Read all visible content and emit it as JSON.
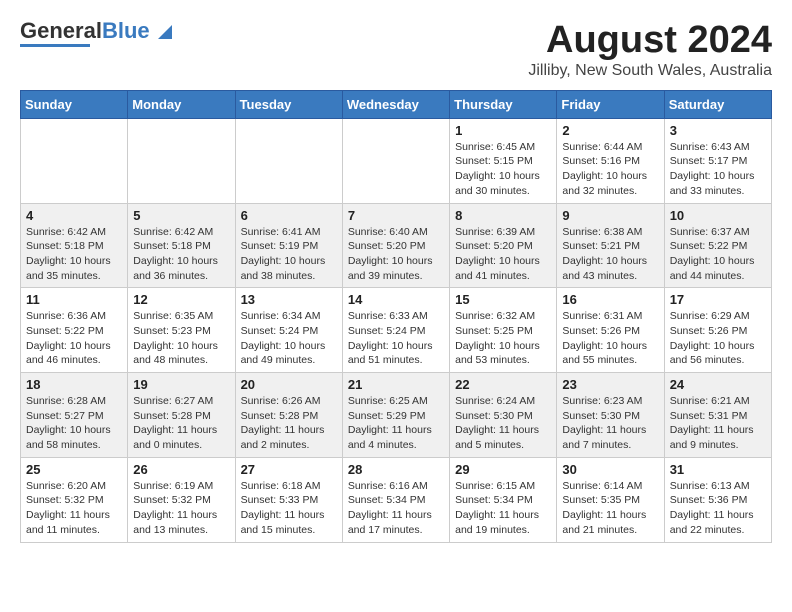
{
  "header": {
    "logo_general": "General",
    "logo_blue": "Blue",
    "month_title": "August 2024",
    "location": "Jilliby, New South Wales, Australia"
  },
  "days_of_week": [
    "Sunday",
    "Monday",
    "Tuesday",
    "Wednesday",
    "Thursday",
    "Friday",
    "Saturday"
  ],
  "weeks": [
    [
      {
        "day": "",
        "info": ""
      },
      {
        "day": "",
        "info": ""
      },
      {
        "day": "",
        "info": ""
      },
      {
        "day": "",
        "info": ""
      },
      {
        "day": "1",
        "info": "Sunrise: 6:45 AM\nSunset: 5:15 PM\nDaylight: 10 hours\nand 30 minutes."
      },
      {
        "day": "2",
        "info": "Sunrise: 6:44 AM\nSunset: 5:16 PM\nDaylight: 10 hours\nand 32 minutes."
      },
      {
        "day": "3",
        "info": "Sunrise: 6:43 AM\nSunset: 5:17 PM\nDaylight: 10 hours\nand 33 minutes."
      }
    ],
    [
      {
        "day": "4",
        "info": "Sunrise: 6:42 AM\nSunset: 5:18 PM\nDaylight: 10 hours\nand 35 minutes."
      },
      {
        "day": "5",
        "info": "Sunrise: 6:42 AM\nSunset: 5:18 PM\nDaylight: 10 hours\nand 36 minutes."
      },
      {
        "day": "6",
        "info": "Sunrise: 6:41 AM\nSunset: 5:19 PM\nDaylight: 10 hours\nand 38 minutes."
      },
      {
        "day": "7",
        "info": "Sunrise: 6:40 AM\nSunset: 5:20 PM\nDaylight: 10 hours\nand 39 minutes."
      },
      {
        "day": "8",
        "info": "Sunrise: 6:39 AM\nSunset: 5:20 PM\nDaylight: 10 hours\nand 41 minutes."
      },
      {
        "day": "9",
        "info": "Sunrise: 6:38 AM\nSunset: 5:21 PM\nDaylight: 10 hours\nand 43 minutes."
      },
      {
        "day": "10",
        "info": "Sunrise: 6:37 AM\nSunset: 5:22 PM\nDaylight: 10 hours\nand 44 minutes."
      }
    ],
    [
      {
        "day": "11",
        "info": "Sunrise: 6:36 AM\nSunset: 5:22 PM\nDaylight: 10 hours\nand 46 minutes."
      },
      {
        "day": "12",
        "info": "Sunrise: 6:35 AM\nSunset: 5:23 PM\nDaylight: 10 hours\nand 48 minutes."
      },
      {
        "day": "13",
        "info": "Sunrise: 6:34 AM\nSunset: 5:24 PM\nDaylight: 10 hours\nand 49 minutes."
      },
      {
        "day": "14",
        "info": "Sunrise: 6:33 AM\nSunset: 5:24 PM\nDaylight: 10 hours\nand 51 minutes."
      },
      {
        "day": "15",
        "info": "Sunrise: 6:32 AM\nSunset: 5:25 PM\nDaylight: 10 hours\nand 53 minutes."
      },
      {
        "day": "16",
        "info": "Sunrise: 6:31 AM\nSunset: 5:26 PM\nDaylight: 10 hours\nand 55 minutes."
      },
      {
        "day": "17",
        "info": "Sunrise: 6:29 AM\nSunset: 5:26 PM\nDaylight: 10 hours\nand 56 minutes."
      }
    ],
    [
      {
        "day": "18",
        "info": "Sunrise: 6:28 AM\nSunset: 5:27 PM\nDaylight: 10 hours\nand 58 minutes."
      },
      {
        "day": "19",
        "info": "Sunrise: 6:27 AM\nSunset: 5:28 PM\nDaylight: 11 hours\nand 0 minutes."
      },
      {
        "day": "20",
        "info": "Sunrise: 6:26 AM\nSunset: 5:28 PM\nDaylight: 11 hours\nand 2 minutes."
      },
      {
        "day": "21",
        "info": "Sunrise: 6:25 AM\nSunset: 5:29 PM\nDaylight: 11 hours\nand 4 minutes."
      },
      {
        "day": "22",
        "info": "Sunrise: 6:24 AM\nSunset: 5:30 PM\nDaylight: 11 hours\nand 5 minutes."
      },
      {
        "day": "23",
        "info": "Sunrise: 6:23 AM\nSunset: 5:30 PM\nDaylight: 11 hours\nand 7 minutes."
      },
      {
        "day": "24",
        "info": "Sunrise: 6:21 AM\nSunset: 5:31 PM\nDaylight: 11 hours\nand 9 minutes."
      }
    ],
    [
      {
        "day": "25",
        "info": "Sunrise: 6:20 AM\nSunset: 5:32 PM\nDaylight: 11 hours\nand 11 minutes."
      },
      {
        "day": "26",
        "info": "Sunrise: 6:19 AM\nSunset: 5:32 PM\nDaylight: 11 hours\nand 13 minutes."
      },
      {
        "day": "27",
        "info": "Sunrise: 6:18 AM\nSunset: 5:33 PM\nDaylight: 11 hours\nand 15 minutes."
      },
      {
        "day": "28",
        "info": "Sunrise: 6:16 AM\nSunset: 5:34 PM\nDaylight: 11 hours\nand 17 minutes."
      },
      {
        "day": "29",
        "info": "Sunrise: 6:15 AM\nSunset: 5:34 PM\nDaylight: 11 hours\nand 19 minutes."
      },
      {
        "day": "30",
        "info": "Sunrise: 6:14 AM\nSunset: 5:35 PM\nDaylight: 11 hours\nand 21 minutes."
      },
      {
        "day": "31",
        "info": "Sunrise: 6:13 AM\nSunset: 5:36 PM\nDaylight: 11 hours\nand 22 minutes."
      }
    ]
  ]
}
